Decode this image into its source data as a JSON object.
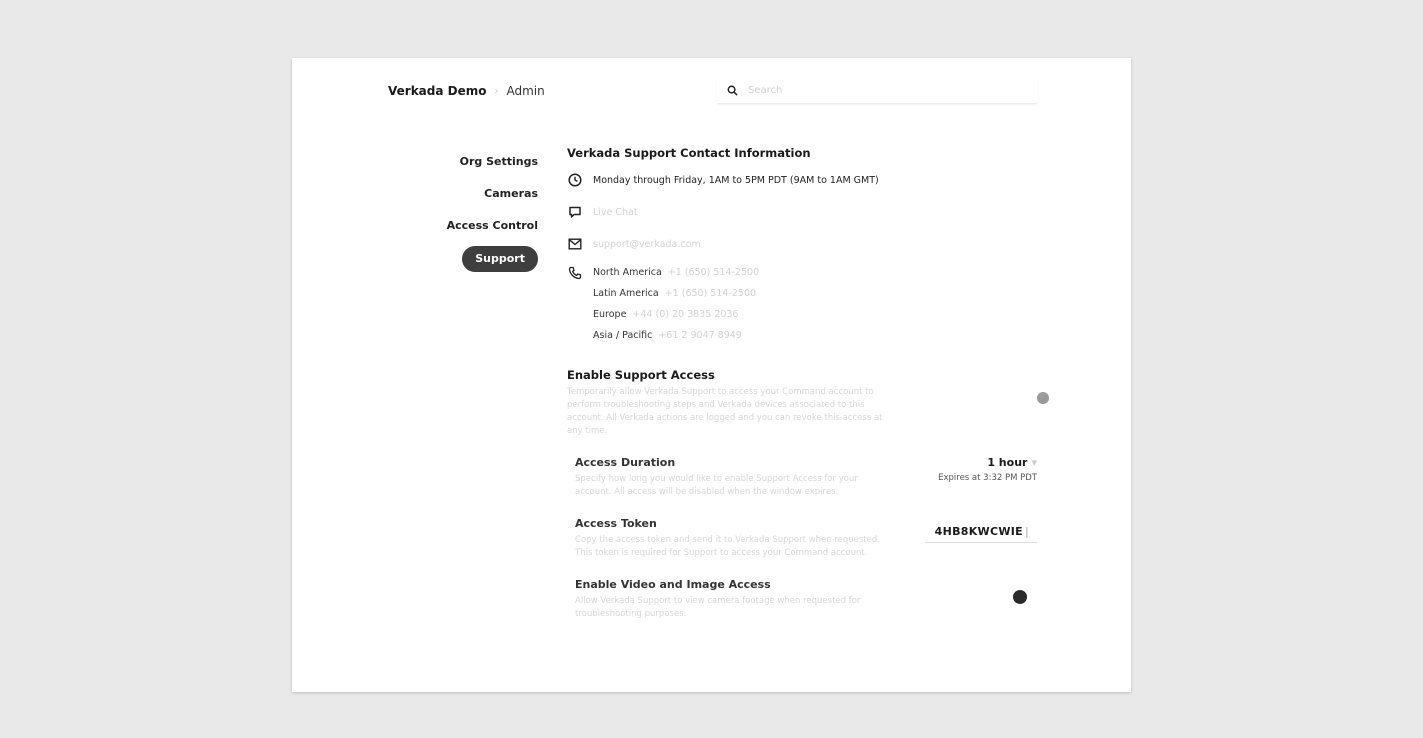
{
  "header": {
    "org_name": "Verkada Demo",
    "separator": "›",
    "role": "Admin"
  },
  "search": {
    "placeholder": "Search"
  },
  "nav": {
    "items": [
      {
        "label": "Org Settings"
      },
      {
        "label": "Cameras"
      },
      {
        "label": "Access Control"
      },
      {
        "label": "Support"
      }
    ],
    "active": "Support"
  },
  "support_info": {
    "title": "Verkada Support Contact Information",
    "hours": "Monday through Friday, 1AM to 5PM PDT (9AM to 1AM GMT)",
    "chat": "Live Chat",
    "email": "support@verkada.com",
    "phones": [
      {
        "region": "North America",
        "number": "+1 (650) 514-2500"
      },
      {
        "region": "Latin America",
        "number": "+1 (650) 514-2500"
      },
      {
        "region": "Europe",
        "number": "+44 (0) 20 3835 2036"
      },
      {
        "region": "Asia / Pacific",
        "number": "+61 2 9047 8949"
      }
    ]
  },
  "support_access": {
    "title": "Enable Support Access",
    "description": "Temporarily allow Verkada Support to access your Command account to perform troubleshooting steps and Verkada devices associated to this account. All Verkada actions are logged and you can revoke this access at any time.",
    "enabled": false
  },
  "access_duration": {
    "title": "Access Duration",
    "description": "Specify how long you would like to enable Support Access for your account. All access will be disabled when the window expires.",
    "value": "1 hour",
    "expires": "Expires at 3:32 PM PDT"
  },
  "access_token": {
    "title": "Access Token",
    "description": "Copy the access token and send it to Verkada Support when requested. This token is required for Support to access your Command account.",
    "value": "4HB8KWCWIE"
  },
  "video_access": {
    "title": "Enable Video and Image Access",
    "description": "Allow Verkada Support to view camera footage when requested for troubleshooting purposes.",
    "enabled": true
  },
  "colors": {
    "active_nav_bg": "#3e3e3e",
    "toggle_on": "#2b2b2b",
    "toggle_off": "#9a9a9a"
  }
}
